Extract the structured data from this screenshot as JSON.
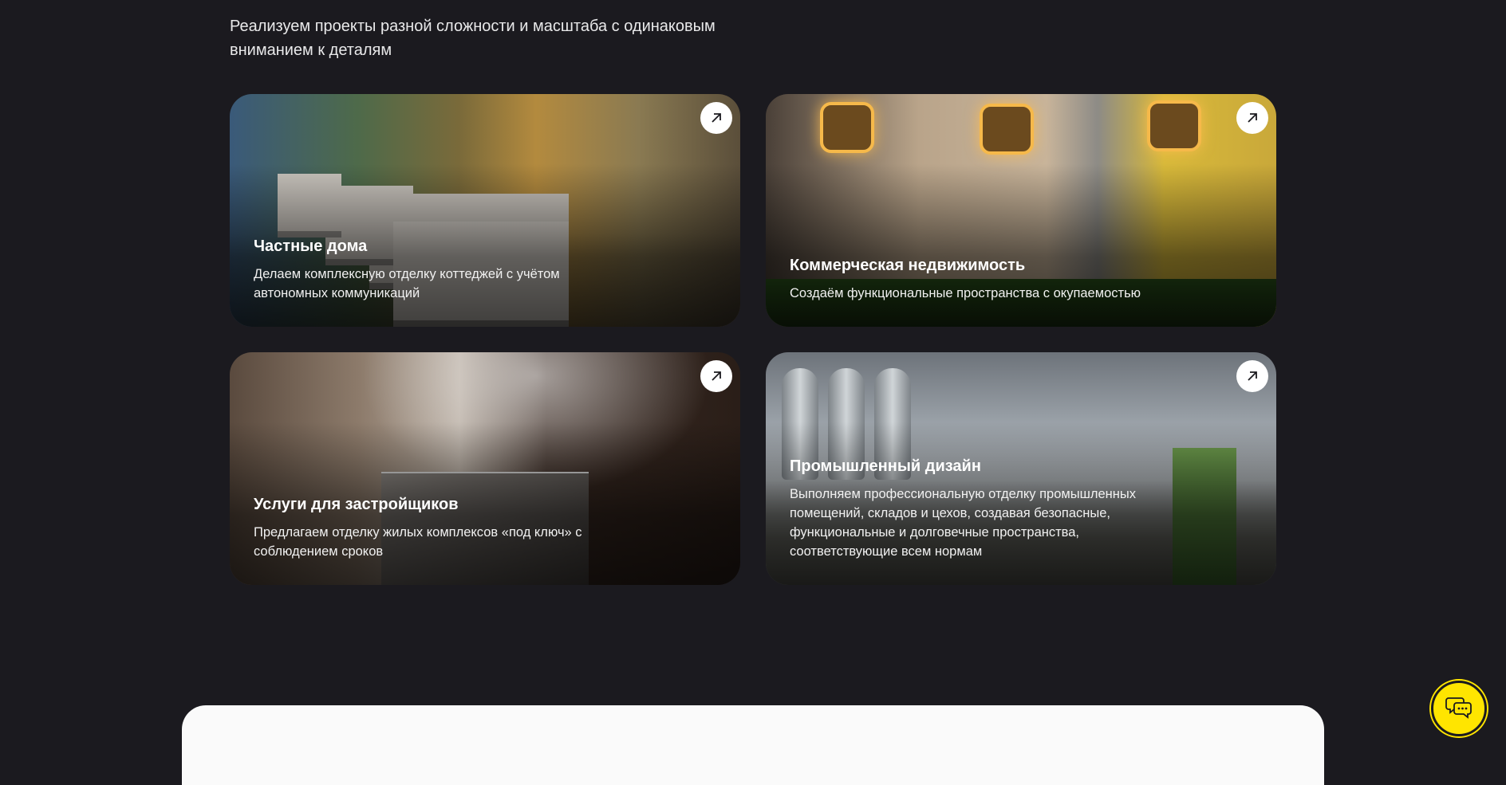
{
  "intro": {
    "text": "Реализуем проекты разной сложности и масштаба с одинаковым вниманием к деталям"
  },
  "cards": [
    {
      "title": "Частные дома",
      "description": "Делаем комплексную отделку коттеджей с учётом автономных коммуникаций",
      "icon": "arrow-up-right-icon"
    },
    {
      "title": "Коммерческая недвижимость",
      "description": "Создаём функциональные пространства с окупаемостью",
      "icon": "arrow-up-right-icon"
    },
    {
      "title": "Услуги для застройщиков",
      "description": "Предлагаем отделку жилых комплексов «под ключ» с соблюдением сроков",
      "icon": "arrow-up-right-icon"
    },
    {
      "title": "Промышленный дизайн",
      "description": "Выполняем профессиональную отделку промышленных помещений, складов и цехов, создавая безопасные, функциональные и долговечные пространства, соответствующие всем нормам",
      "icon": "arrow-up-right-icon"
    }
  ],
  "chat": {
    "icon": "chat-bubbles-icon",
    "color": "#ffe500"
  },
  "colors": {
    "background": "#1b1a1f",
    "panel": "#fafafa",
    "accent": "#ffe500"
  }
}
